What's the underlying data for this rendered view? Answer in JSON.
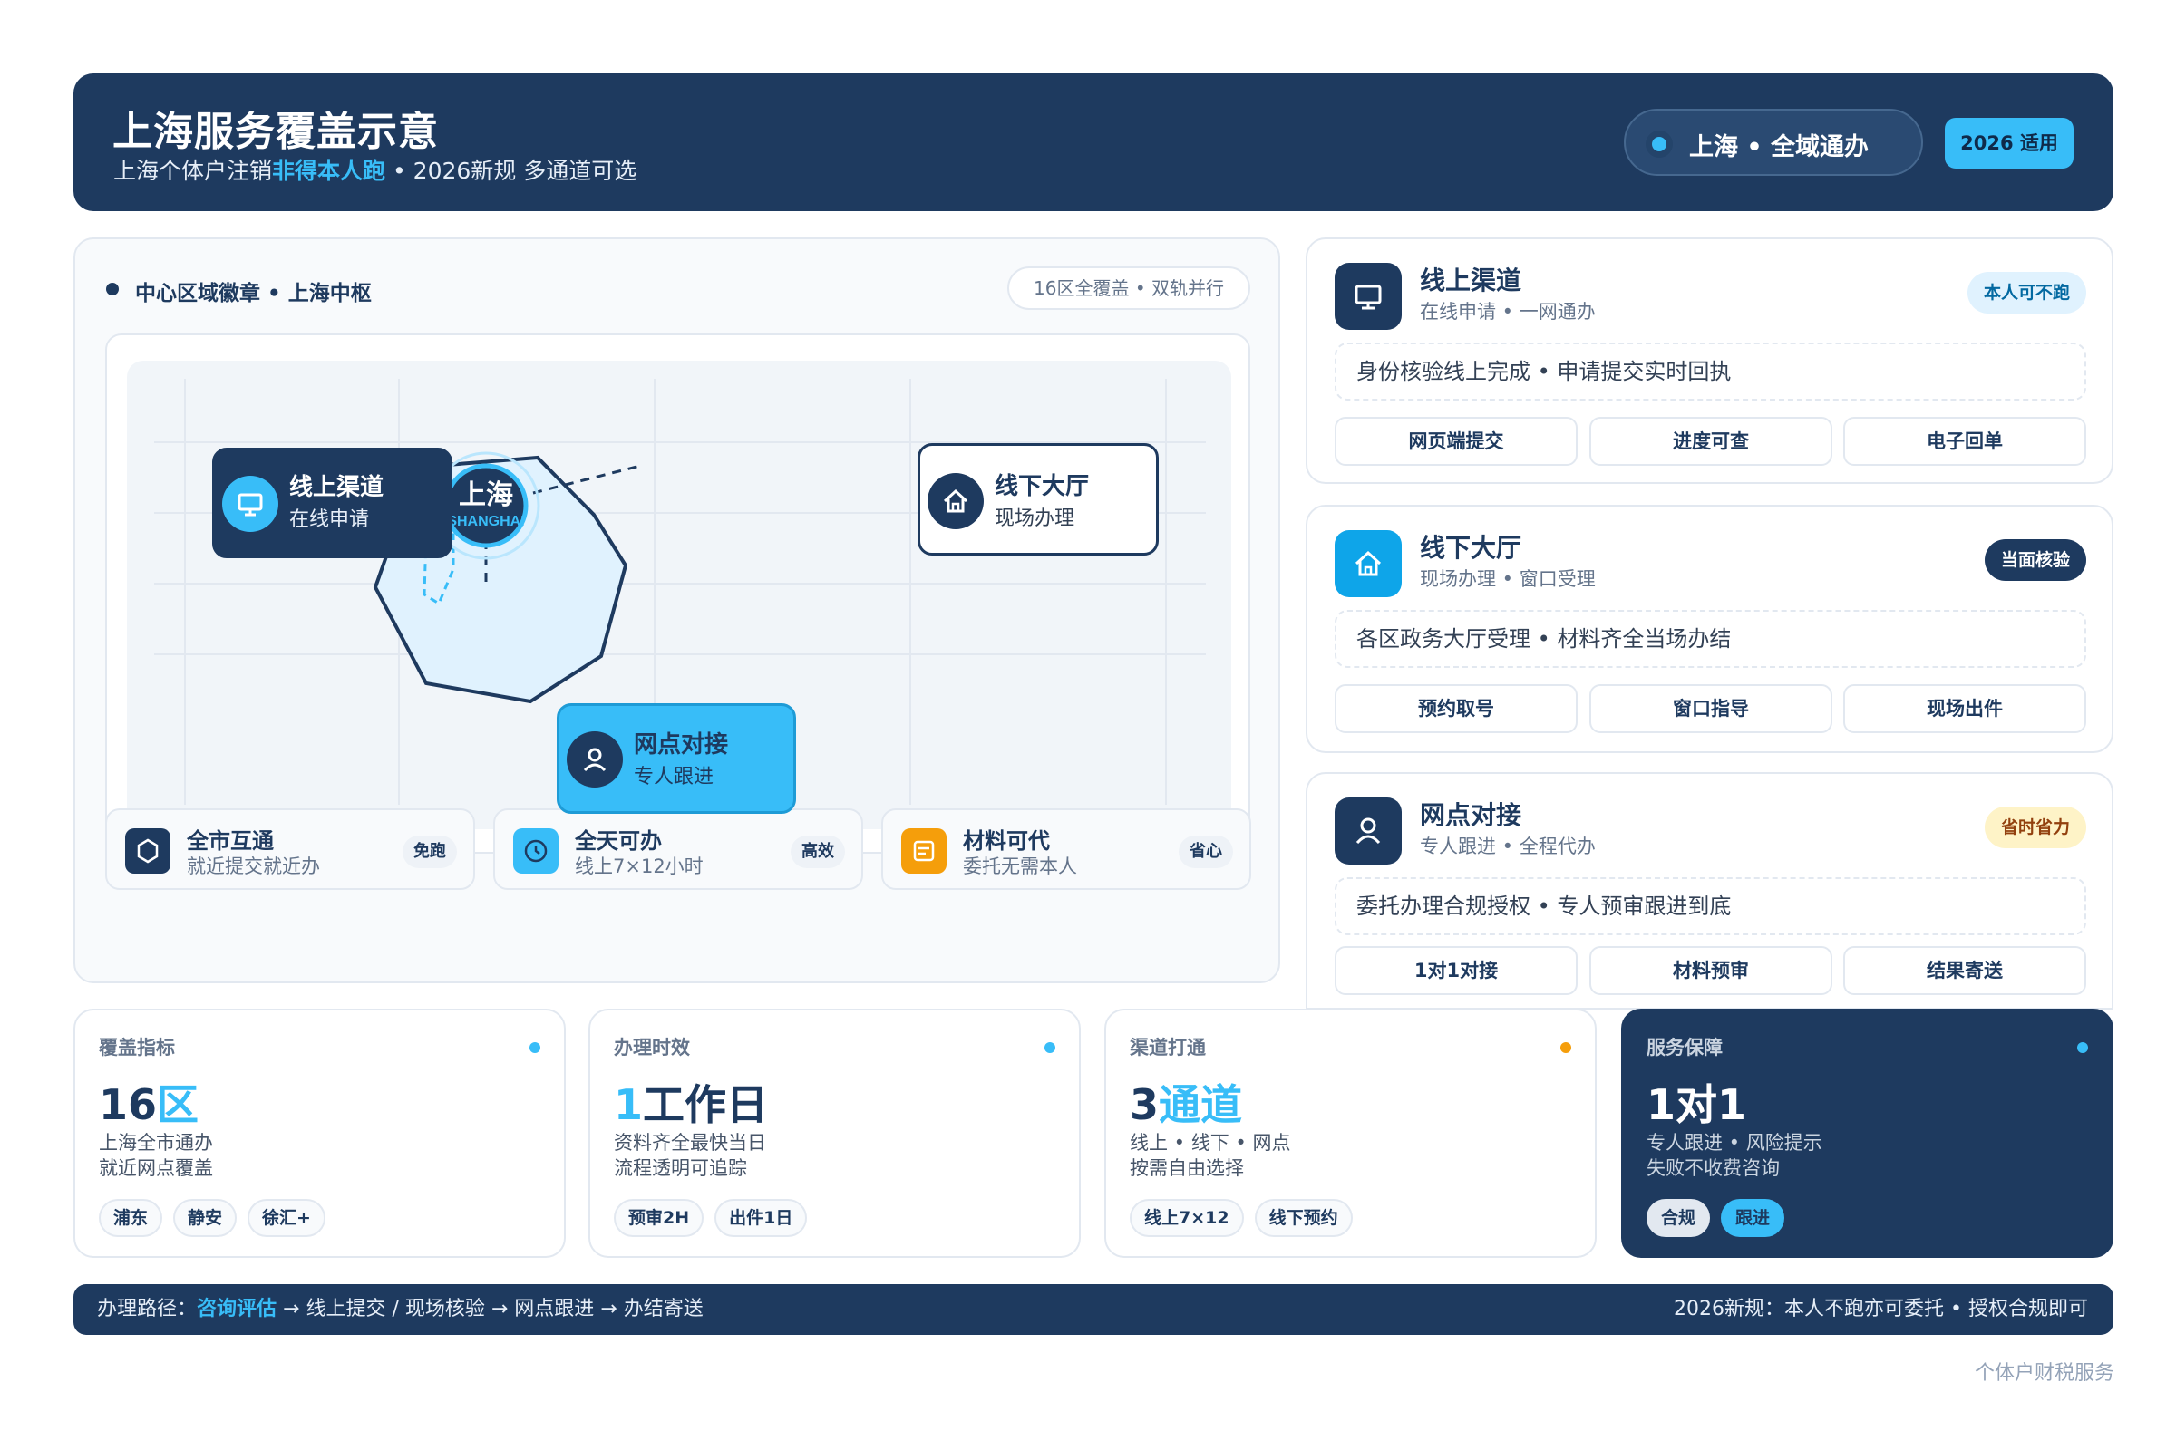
{
  "header": {
    "title": "上海服务覆盖示意",
    "subtitle_pre": "上海个体户注销",
    "subtitle_hl": "非得本人跑",
    "subtitle_post": " • 2026新规 多通道可选",
    "region_pill": "上海 • 全域通办",
    "year_pill": "2026 适用"
  },
  "map": {
    "section_title": "中心区域徽章 • 上海中枢",
    "section_pill": "16区全覆盖 • 双轨并行",
    "center_title": "上海",
    "center_sub": "SHANGHAI",
    "nodes": {
      "online": {
        "title": "线上渠道",
        "sub": "在线申请",
        "icon": "monitor-icon"
      },
      "offline": {
        "title": "线下大厅",
        "sub": "现场办理",
        "icon": "home-icon"
      },
      "branch": {
        "title": "网点对接",
        "sub": "专人跟进",
        "icon": "user-icon"
      }
    }
  },
  "features": [
    {
      "title": "全市互通",
      "sub": "就近提交就近办",
      "tag": "免跑",
      "icon": "hexagon-icon",
      "color": "#1e3a5f"
    },
    {
      "title": "全天可办",
      "sub": "线上7×12小时",
      "tag": "高效",
      "icon": "clock-icon",
      "color": "#38bdf8"
    },
    {
      "title": "材料可代",
      "sub": "委托无需本人",
      "tag": "省心",
      "icon": "document-icon",
      "color": "#f59e0b"
    }
  ],
  "channels": [
    {
      "title": "线上渠道",
      "sub": "在线申请 • 一网通办",
      "badge": "本人可不跑",
      "desc": "身份核验线上完成 • 申请提交实时回执",
      "buttons": [
        "网页端提交",
        "进度可查",
        "电子回单"
      ],
      "icon": "monitor-icon"
    },
    {
      "title": "线下大厅",
      "sub": "现场办理 • 窗口受理",
      "badge": "当面核验",
      "desc": "各区政务大厅受理 • 材料齐全当场办结",
      "buttons": [
        "预约取号",
        "窗口指导",
        "现场出件"
      ],
      "icon": "home-icon"
    },
    {
      "title": "网点对接",
      "sub": "专人跟进 • 全程代办",
      "badge": "省时省力",
      "desc": "委托办理合规授权 • 专人预审跟进到底",
      "buttons": [
        "1对1对接",
        "材料预审",
        "结果寄送"
      ],
      "icon": "user-icon"
    }
  ],
  "stats": [
    {
      "label": "覆盖指标",
      "num": "16",
      "unit": "区",
      "line1": "上海全市通办",
      "line2": "就近网点覆盖",
      "chips": [
        "浦东",
        "静安",
        "徐汇+"
      ],
      "dot": "#38bdf8"
    },
    {
      "label": "办理时效",
      "num": "1",
      "unit": "工作日",
      "line1": "资料齐全最快当日",
      "line2": "流程透明可追踪",
      "chips": [
        "预审2H",
        "出件1日"
      ],
      "dot": "#38bdf8"
    },
    {
      "label": "渠道打通",
      "num": "3",
      "unit": "通道",
      "line1": "线上 • 线下 • 网点",
      "line2": "按需自由选择",
      "chips": [
        "线上7×12",
        "线下预约"
      ],
      "dot": "#f59e0b"
    },
    {
      "label": "服务保障",
      "num": "1对1",
      "unit": "",
      "line1": "专人跟进 • 风险提示",
      "line2": "失败不收费咨询",
      "chips": [
        "合规",
        "跟进"
      ],
      "dot": "#38bdf8"
    }
  ],
  "footer": {
    "path_label": "办理路径：",
    "path_hl": "咨询评估",
    "path_rest": " → 线上提交 / 现场核验 → 网点跟进 → 办结寄送",
    "note": "2026新规：本人不跑亦可委托 • 授权合规即可"
  },
  "brand": "个体户财税服务",
  "colors": {
    "navy": "#1e3a5f",
    "sky": "#38bdf8",
    "amber": "#f59e0b"
  }
}
